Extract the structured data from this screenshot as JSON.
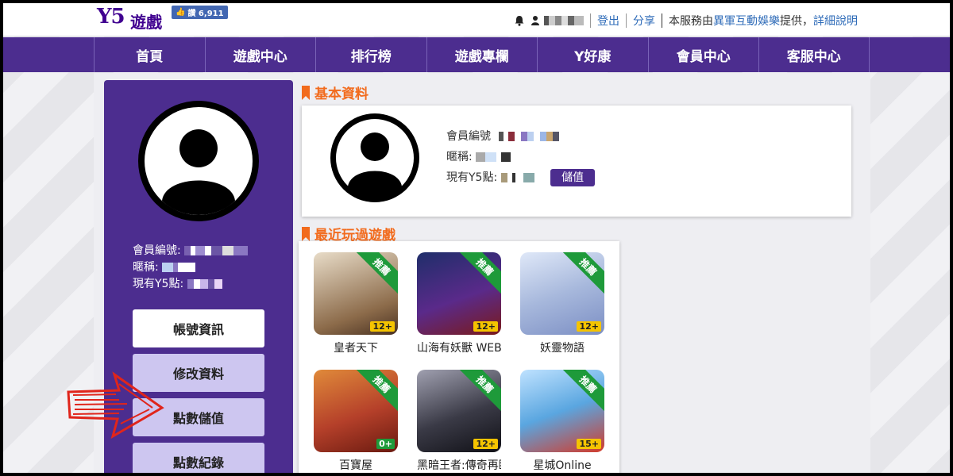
{
  "header": {
    "logo": "Y5",
    "logo_sub": "遊戲",
    "fb_like": "讚 6,911",
    "logout": "登出",
    "share": "分享",
    "service_prefix": "本服務由",
    "provider": "異軍互動娛樂",
    "service_suffix": "提供",
    "details": "詳細說明"
  },
  "nav": {
    "items": [
      "首頁",
      "遊戲中心",
      "排行榜",
      "遊戲專欄",
      "Y好康",
      "會員中心",
      "客服中心"
    ]
  },
  "sidebar": {
    "member_id_label": "會員編號:",
    "nickname_label": "暱稱:",
    "points_label": "現有Y5點:",
    "buttons": [
      "帳號資訊",
      "修改資料",
      "點數儲值",
      "點數紀錄"
    ]
  },
  "basic_info": {
    "title": "基本資料",
    "member_id_label": "會員編號",
    "nickname_label": "暱稱:",
    "points_label": "現有Y5點:",
    "topup_button": "儲值"
  },
  "recent_games": {
    "title": "最近玩過遊戲",
    "badge": "推薦",
    "games": [
      {
        "name": "皇者天下",
        "age": "12+",
        "color": "#b9a58b"
      },
      {
        "name": "山海有妖獸 WEB",
        "age": "12+",
        "color": "#3a2a6a"
      },
      {
        "name": "妖靈物語",
        "age": "12+",
        "color": "#a7b8dc"
      },
      {
        "name": "百寶屋",
        "age": "0+",
        "color": "#b5402a"
      },
      {
        "name": "黑暗王者:傳奇再臨",
        "age": "12+",
        "color": "#3a3a46"
      },
      {
        "name": "星城Online",
        "age": "15+",
        "color": "#5aa6e0"
      }
    ]
  },
  "colors": {
    "brand_purple": "#4c2d8f",
    "accent_orange": "#f26b1d",
    "recommend_green": "#1e9a3a"
  }
}
